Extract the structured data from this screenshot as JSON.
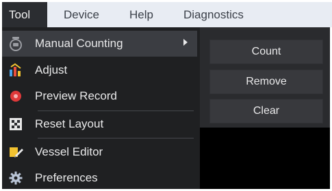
{
  "menubar": {
    "items": [
      {
        "label": "Tool",
        "active": true
      },
      {
        "label": "Device",
        "active": false
      },
      {
        "label": "Help",
        "active": false
      },
      {
        "label": "Diagnostics",
        "active": false
      }
    ]
  },
  "tool_menu": {
    "items": [
      {
        "label": "Manual Counting",
        "icon": "counter-icon",
        "has_submenu": true,
        "highlighted": true
      },
      {
        "label": "Adjust",
        "icon": "adjust-icon"
      },
      {
        "label": "Preview Record",
        "icon": "record-icon"
      },
      {
        "label": "Reset Layout",
        "icon": "layout-icon"
      },
      {
        "label": "Vessel Editor",
        "icon": "vessel-editor-icon"
      },
      {
        "label": "Preferences",
        "icon": "gear-icon"
      }
    ]
  },
  "submenu": {
    "buttons": [
      {
        "label": "Count"
      },
      {
        "label": "Remove"
      },
      {
        "label": "Clear"
      }
    ]
  },
  "colors": {
    "menubar_bg": "#e8ecf3",
    "menu_bg": "#1f2022",
    "highlight_bg": "#3b3d42",
    "record_red": "#e0393a",
    "editor_yellow": "#f2c230"
  }
}
